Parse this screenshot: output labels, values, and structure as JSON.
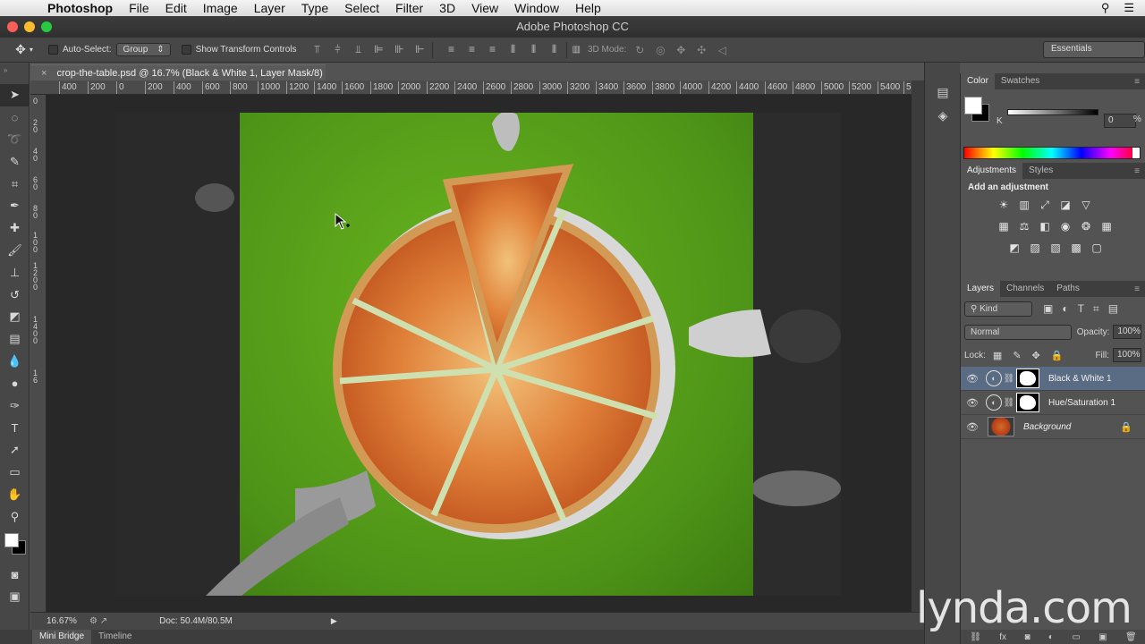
{
  "menubar": {
    "items": [
      "Photoshop",
      "File",
      "Edit",
      "Image",
      "Layer",
      "Type",
      "Select",
      "Filter",
      "3D",
      "View",
      "Window",
      "Help"
    ]
  },
  "window": {
    "title": "Adobe Photoshop CC"
  },
  "options": {
    "auto_select_label": "Auto-Select:",
    "auto_select_value": "Group",
    "show_transform_label": "Show Transform Controls",
    "mode_3d_label": "3D Mode:",
    "workspace": "Essentials"
  },
  "document": {
    "tab_title": "crop-the-table.psd @ 16.7% (Black & White 1, Layer Mask/8)",
    "zoom": "16.67%",
    "doc_size": "Doc: 50.4M/80.5M"
  },
  "ruler": {
    "top_ticks": [
      "400",
      "200",
      "0",
      "200",
      "400",
      "600",
      "800",
      "1000",
      "1200",
      "1400",
      "1600",
      "1800",
      "2000",
      "2200",
      "2400",
      "2600",
      "2800",
      "3000",
      "3200",
      "3400",
      "3600",
      "3800",
      "4000",
      "4200",
      "4400",
      "4600",
      "4800",
      "5000",
      "5200",
      "5400",
      "5"
    ],
    "left_ticks": [
      "0",
      "2",
      "0",
      "4",
      "0",
      "6",
      "0",
      "8",
      "0",
      "1",
      "0",
      "0",
      "1",
      "2",
      "0",
      "0",
      "1",
      "4",
      "0",
      "0",
      "1",
      "6"
    ]
  },
  "bottom_tabs": [
    "Mini Bridge",
    "Timeline"
  ],
  "panels": {
    "color_tabs": [
      "Color",
      "Swatches"
    ],
    "k_label": "K",
    "k_value": "0",
    "k_unit": "%",
    "adjust_tabs": [
      "Adjustments",
      "Styles"
    ],
    "add_adjustment": "Add an adjustment",
    "layer_tabs": [
      "Layers",
      "Channels",
      "Paths"
    ],
    "kind": "Kind",
    "blend_mode": "Normal",
    "opacity_label": "Opacity:",
    "opacity_value": "100%",
    "lock_label": "Lock:",
    "fill_label": "Fill:",
    "fill_value": "100%",
    "layers": [
      {
        "name": "Black & White 1"
      },
      {
        "name": "Hue/Saturation 1"
      },
      {
        "name": "Background"
      }
    ]
  },
  "watermark": "lynda.com",
  "colors": {
    "board_green": "#5aa41a",
    "selected_layer": "#5a6b84"
  }
}
